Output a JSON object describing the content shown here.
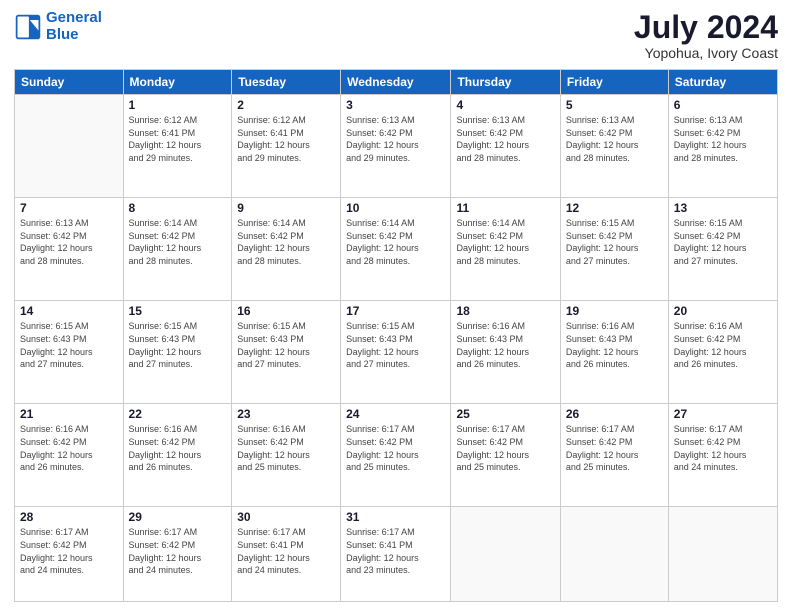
{
  "logo": {
    "line1": "General",
    "line2": "Blue"
  },
  "title": "July 2024",
  "subtitle": "Yopohua, Ivory Coast",
  "weekdays": [
    "Sunday",
    "Monday",
    "Tuesday",
    "Wednesday",
    "Thursday",
    "Friday",
    "Saturday"
  ],
  "weeks": [
    [
      {
        "day": "",
        "info": ""
      },
      {
        "day": "1",
        "info": "Sunrise: 6:12 AM\nSunset: 6:41 PM\nDaylight: 12 hours\nand 29 minutes."
      },
      {
        "day": "2",
        "info": "Sunrise: 6:12 AM\nSunset: 6:41 PM\nDaylight: 12 hours\nand 29 minutes."
      },
      {
        "day": "3",
        "info": "Sunrise: 6:13 AM\nSunset: 6:42 PM\nDaylight: 12 hours\nand 29 minutes."
      },
      {
        "day": "4",
        "info": "Sunrise: 6:13 AM\nSunset: 6:42 PM\nDaylight: 12 hours\nand 28 minutes."
      },
      {
        "day": "5",
        "info": "Sunrise: 6:13 AM\nSunset: 6:42 PM\nDaylight: 12 hours\nand 28 minutes."
      },
      {
        "day": "6",
        "info": "Sunrise: 6:13 AM\nSunset: 6:42 PM\nDaylight: 12 hours\nand 28 minutes."
      }
    ],
    [
      {
        "day": "7",
        "info": "Sunrise: 6:13 AM\nSunset: 6:42 PM\nDaylight: 12 hours\nand 28 minutes."
      },
      {
        "day": "8",
        "info": "Sunrise: 6:14 AM\nSunset: 6:42 PM\nDaylight: 12 hours\nand 28 minutes."
      },
      {
        "day": "9",
        "info": "Sunrise: 6:14 AM\nSunset: 6:42 PM\nDaylight: 12 hours\nand 28 minutes."
      },
      {
        "day": "10",
        "info": "Sunrise: 6:14 AM\nSunset: 6:42 PM\nDaylight: 12 hours\nand 28 minutes."
      },
      {
        "day": "11",
        "info": "Sunrise: 6:14 AM\nSunset: 6:42 PM\nDaylight: 12 hours\nand 28 minutes."
      },
      {
        "day": "12",
        "info": "Sunrise: 6:15 AM\nSunset: 6:42 PM\nDaylight: 12 hours\nand 27 minutes."
      },
      {
        "day": "13",
        "info": "Sunrise: 6:15 AM\nSunset: 6:42 PM\nDaylight: 12 hours\nand 27 minutes."
      }
    ],
    [
      {
        "day": "14",
        "info": "Sunrise: 6:15 AM\nSunset: 6:43 PM\nDaylight: 12 hours\nand 27 minutes."
      },
      {
        "day": "15",
        "info": "Sunrise: 6:15 AM\nSunset: 6:43 PM\nDaylight: 12 hours\nand 27 minutes."
      },
      {
        "day": "16",
        "info": "Sunrise: 6:15 AM\nSunset: 6:43 PM\nDaylight: 12 hours\nand 27 minutes."
      },
      {
        "day": "17",
        "info": "Sunrise: 6:15 AM\nSunset: 6:43 PM\nDaylight: 12 hours\nand 27 minutes."
      },
      {
        "day": "18",
        "info": "Sunrise: 6:16 AM\nSunset: 6:43 PM\nDaylight: 12 hours\nand 26 minutes."
      },
      {
        "day": "19",
        "info": "Sunrise: 6:16 AM\nSunset: 6:43 PM\nDaylight: 12 hours\nand 26 minutes."
      },
      {
        "day": "20",
        "info": "Sunrise: 6:16 AM\nSunset: 6:42 PM\nDaylight: 12 hours\nand 26 minutes."
      }
    ],
    [
      {
        "day": "21",
        "info": "Sunrise: 6:16 AM\nSunset: 6:42 PM\nDaylight: 12 hours\nand 26 minutes."
      },
      {
        "day": "22",
        "info": "Sunrise: 6:16 AM\nSunset: 6:42 PM\nDaylight: 12 hours\nand 26 minutes."
      },
      {
        "day": "23",
        "info": "Sunrise: 6:16 AM\nSunset: 6:42 PM\nDaylight: 12 hours\nand 25 minutes."
      },
      {
        "day": "24",
        "info": "Sunrise: 6:17 AM\nSunset: 6:42 PM\nDaylight: 12 hours\nand 25 minutes."
      },
      {
        "day": "25",
        "info": "Sunrise: 6:17 AM\nSunset: 6:42 PM\nDaylight: 12 hours\nand 25 minutes."
      },
      {
        "day": "26",
        "info": "Sunrise: 6:17 AM\nSunset: 6:42 PM\nDaylight: 12 hours\nand 25 minutes."
      },
      {
        "day": "27",
        "info": "Sunrise: 6:17 AM\nSunset: 6:42 PM\nDaylight: 12 hours\nand 24 minutes."
      }
    ],
    [
      {
        "day": "28",
        "info": "Sunrise: 6:17 AM\nSunset: 6:42 PM\nDaylight: 12 hours\nand 24 minutes."
      },
      {
        "day": "29",
        "info": "Sunrise: 6:17 AM\nSunset: 6:42 PM\nDaylight: 12 hours\nand 24 minutes."
      },
      {
        "day": "30",
        "info": "Sunrise: 6:17 AM\nSunset: 6:41 PM\nDaylight: 12 hours\nand 24 minutes."
      },
      {
        "day": "31",
        "info": "Sunrise: 6:17 AM\nSunset: 6:41 PM\nDaylight: 12 hours\nand 23 minutes."
      },
      {
        "day": "",
        "info": ""
      },
      {
        "day": "",
        "info": ""
      },
      {
        "day": "",
        "info": ""
      }
    ]
  ]
}
